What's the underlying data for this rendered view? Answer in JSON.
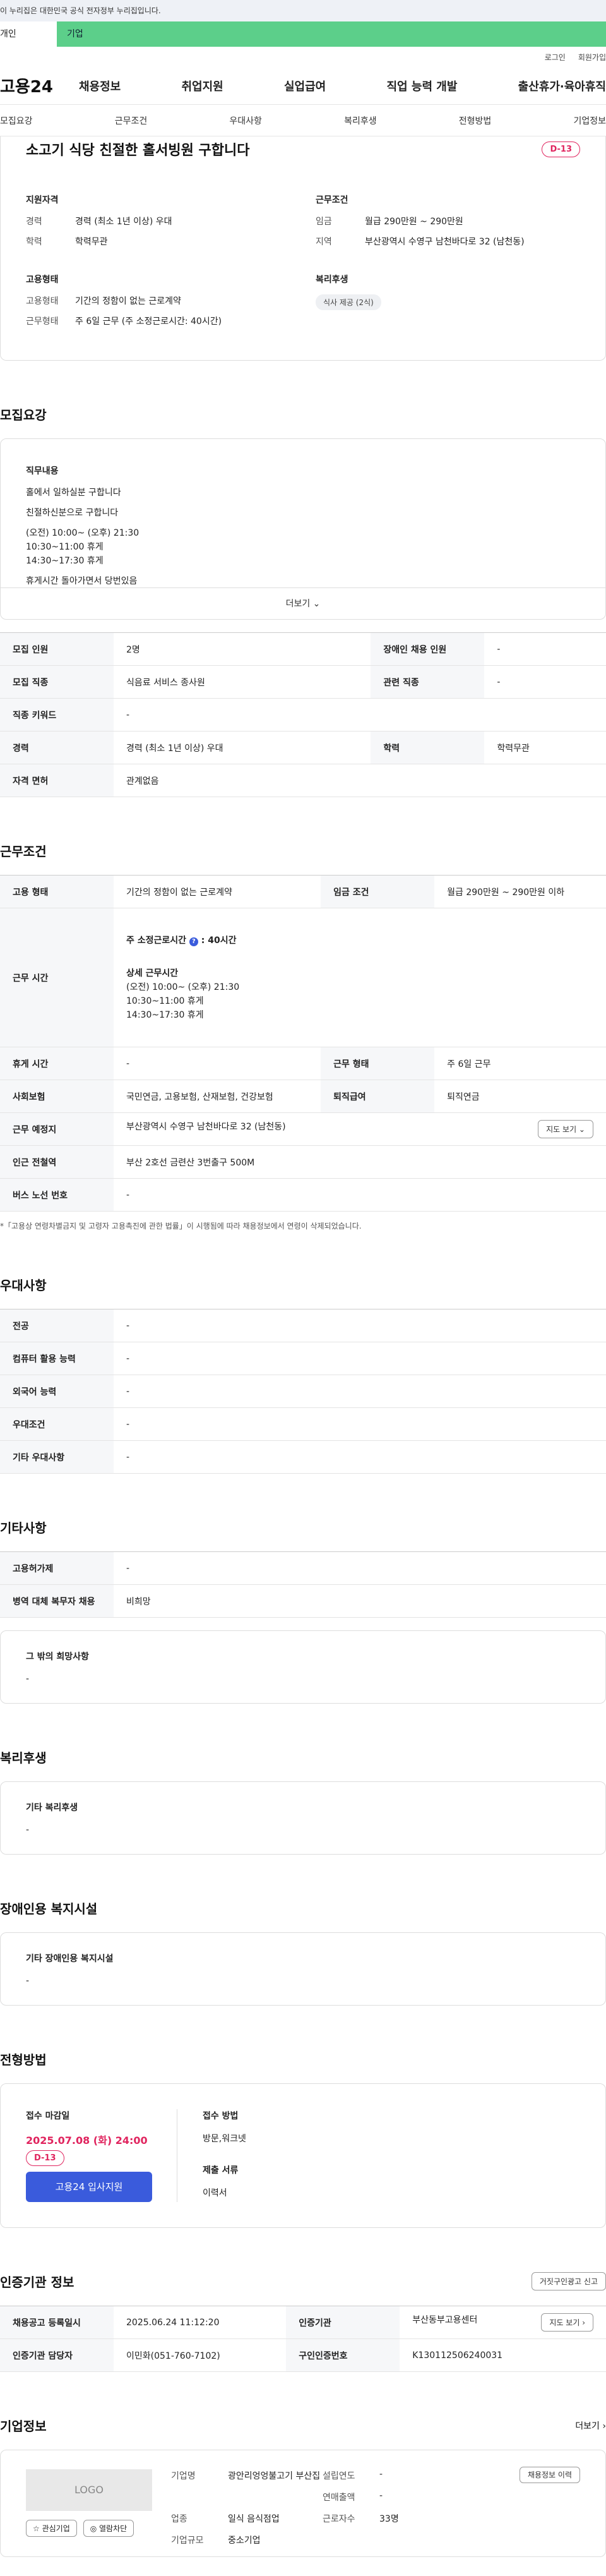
{
  "banner": "이 누리집은 대한민국 공식 전자정부 누리집입니다.",
  "top_tabs": [
    "개인",
    "기업"
  ],
  "util": [
    "로그인",
    "회원가입"
  ],
  "logo": "고용24",
  "gnb": [
    "채용정보",
    "취업지원",
    "실업급여",
    "직업 능력 개발",
    "출산휴가·육아휴직"
  ],
  "lnb": [
    "모집요강",
    "근무조건",
    "우대사항",
    "복리후생",
    "전형방법",
    "기업정보"
  ],
  "head": {
    "title": "소고기 식당 친절한 홀서빙원 구합니다",
    "dday": "D-13"
  },
  "summary": {
    "qual_h": "지원자격",
    "career_k": "경력",
    "career_v": "경력 (최소 1년 이상) 우대",
    "edu_k": "학력",
    "edu_v": "학력무관",
    "cond_h": "근무조건",
    "wage_k": "임금",
    "wage_v": "월급 290만원 ~ 290만원",
    "region_k": "지역",
    "region_v": "부산광역시 수영구 남천바다로 32 (남천동)",
    "emp_h": "고용형태",
    "emptype_k": "고용형태",
    "emptype_v": "기간의 정함이 없는 근로계약",
    "worktype_k": "근무형태",
    "worktype_v": "주 6일 근무 (주 소정근로시간: 40시간)",
    "ben_h": "복리후생",
    "ben_v": "식사 제공 (2식)"
  },
  "recruit": {
    "title": "모집요강",
    "job_h": "직무내용",
    "lines": [
      "홀에서 일하실분 구합니다",
      "친절하신분으로 구합니다",
      "(오전) 10:00~ (오후) 21:30",
      "10:30~11:00 휴게",
      "14:30~17:30 휴게",
      "휴게시간 돌아가면서 당번있음"
    ],
    "more": "더보기 ⌄",
    "rows": [
      [
        "모집 인원",
        "2명",
        "장애인 채용 인원",
        "-"
      ],
      [
        "모집 직종",
        "식음료 서비스 종사원",
        "관련 직종",
        "-"
      ],
      [
        "직종 키워드",
        "-"
      ],
      [
        "경력",
        "경력 (최소 1년 이상) 우대",
        "학력",
        "학력무관"
      ],
      [
        "자격 면허",
        "관계없음"
      ]
    ]
  },
  "work": {
    "title": "근무조건",
    "emp_k": "고용 형태",
    "emp_v": "기간의 정함이 없는 근로계약",
    "wage_k": "임금 조건",
    "wage_v": "월급 290만원 ~ 290만원 이하",
    "time_k": "근무 시간",
    "time_a": "주 소정근로시간",
    "time_b": "40시간",
    "time_detail_h": "상세 근무시간",
    "time_lines": [
      "(오전) 10:00~ (오후) 21:30",
      "10:30~11:00 휴게",
      "14:30~17:30 휴게"
    ],
    "rest_k": "휴게 시간",
    "rest_v": "-",
    "form_k": "근무 형태",
    "form_v": "주 6일 근무",
    "ins_k": "사회보험",
    "ins_v": "국민연금, 고용보험, 산재보험, 건강보험",
    "sev_k": "퇴직급여",
    "sev_v": "퇴직연금",
    "place_k": "근무 예정지",
    "place_v": "부산광역시 수영구 남천바다로 32 (남천동)",
    "map": "지도 보기 ⌄",
    "sub_k": "인근 전철역",
    "sub_v": "부산 2호선 금련산 3번출구 500M",
    "bus_k": "버스 노선 번호",
    "bus_v": "-",
    "note": "*「고용상 연령차별금지 및 고령자 고용촉진에 관한 법률」이 시행됨에 따라 채용정보에서 연령이 삭제되었습니다."
  },
  "pref": {
    "title": "우대사항",
    "rows": [
      [
        "전공",
        "-"
      ],
      [
        "컴퓨터 활용 능력",
        "-"
      ],
      [
        "외국어 능력",
        "-"
      ],
      [
        "우대조건",
        "-"
      ],
      [
        "기타 우대사항",
        "-"
      ]
    ]
  },
  "etc": {
    "title": "기타사항",
    "rows": [
      [
        "고용허가제",
        "-"
      ],
      [
        "병역 대체 복무자 채용",
        "비희망"
      ]
    ],
    "box_h": "그 밖의 희망사항",
    "box_v": "-"
  },
  "welfare": {
    "title": "복리후생",
    "box_h": "기타 복리후생",
    "box_v": "-"
  },
  "facility": {
    "title": "장애인용 복지시설",
    "box_h": "기타 장애인용 복지시설",
    "box_v": "-"
  },
  "screen": {
    "title": "전형방법",
    "deadline_h": "접수 마감일",
    "deadline": "2025.07.08 (화) 24:00",
    "dday": "D-13",
    "btn": "고용24 입사지원",
    "method_h": "접수 방법",
    "method_v": "방문,워크넷",
    "docs_h": "제출 서류",
    "docs_v": "이력서"
  },
  "cert": {
    "title": "인증기관 정보",
    "report": "거짓구인광고 신고",
    "reg_k": "채용공고 등록일시",
    "reg_v": "2025.06.24 11:12:20",
    "org_k": "인증기관",
    "org_v": "부산동부고용센터",
    "map": "지도 보기 ›",
    "mgr_k": "인증기관 담당자",
    "mgr_v": "이민화(051-760-7102)",
    "no_k": "구인인증번호",
    "no_v": "K130112506240031"
  },
  "corp": {
    "title": "기업정보",
    "more": "더보기 ›",
    "logo": "LOGO",
    "fav": "☆ 관심기업",
    "block": "◎ 열람차단",
    "name_k": "기업명",
    "name_v": "광안리엉엉불고기 부산집",
    "found_k": "설립연도",
    "found_v": "-",
    "sales_k": "연매출액",
    "sales_v": "-",
    "ind_k": "업종",
    "ind_v": "일식 음식점업",
    "emp_k": "근로자수",
    "emp_v": "33명",
    "size_k": "기업규모",
    "size_v": "중소기업",
    "jobs": "채용정보 이력"
  }
}
